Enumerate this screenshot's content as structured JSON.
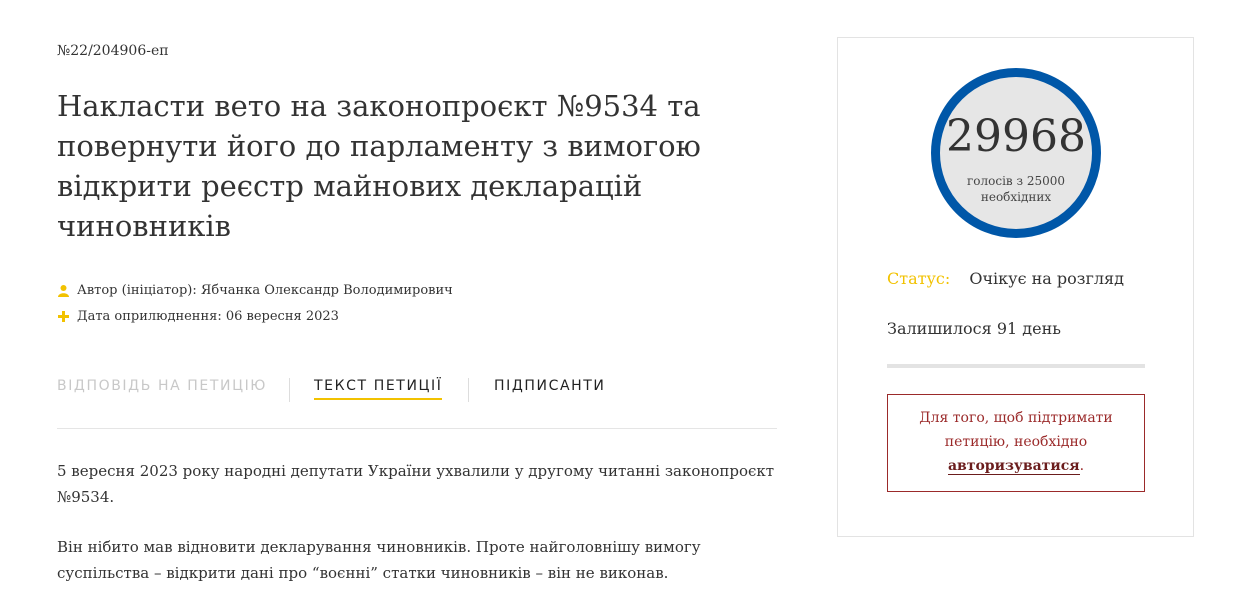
{
  "petition": {
    "number": "№22/204906-еп",
    "title": "Накласти вето на законопроєкт №9534 та повернути його до парламенту з вимогою відкрити реєстр майнових декларацій чиновників",
    "author": "Автор (ініціатор): Ябчанка Олександр Володимирович",
    "date": "Дата оприлюднення: 06 вересня 2023"
  },
  "tabs": [
    {
      "label": "Відповідь на петицію",
      "state": "disabled"
    },
    {
      "label": "Текст петиції",
      "state": "active"
    },
    {
      "label": "Підписанти",
      "state": "normal"
    }
  ],
  "body": [
    "5 вересня 2023 року народні депутати України ухвалили у другому читанні законопроєкт №9534.",
    "Він нібито мав відновити декларування чиновників. Проте найголовнішу вимогу суспільства – відкрити дані про “воєнні” статки чиновників – він не виконав."
  ],
  "sidebar": {
    "votes": "29968",
    "votes_caption": "голосів з 25000 необхідних",
    "status_label": "Статус:",
    "status_value": "Очікує на розгляд",
    "remaining": "Залишилося 91 день",
    "login_prefix": "Для того, щоб підтримати петицію, необхідно",
    "login_link": "авторизуватися",
    "login_suffix": "."
  },
  "colors": {
    "accent": "#f2c200",
    "ring": "#0057a8",
    "alert": "#9b2a2a"
  },
  "icons": {
    "author": "user-icon",
    "date": "plus-icon"
  }
}
